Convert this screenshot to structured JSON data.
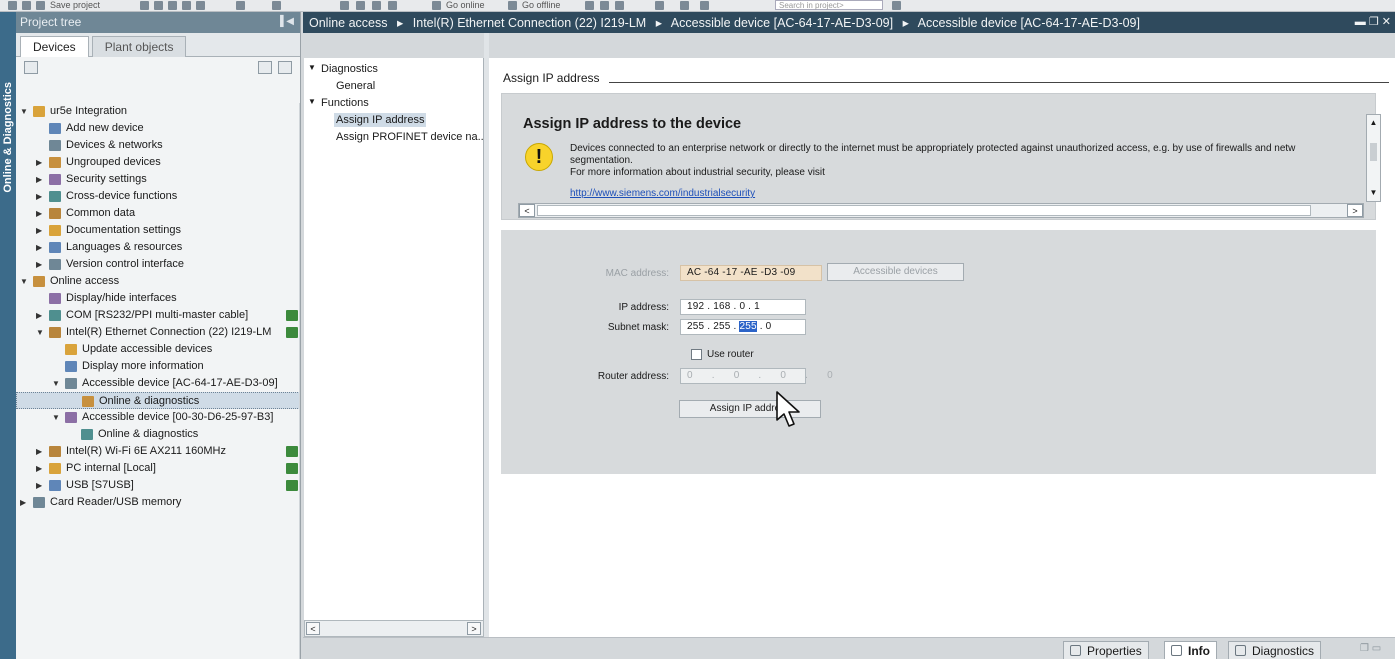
{
  "toolbar": {
    "save_label": "Save project",
    "go_online": "Go online",
    "go_offline": "Go offline",
    "search_placeholder": "Search in project>"
  },
  "side_tab": {
    "label": "Online & Diagnostics"
  },
  "project_tree": {
    "title": "Project tree",
    "tabs": [
      {
        "label": "Devices",
        "active": true
      },
      {
        "label": "Plant objects",
        "active": false
      }
    ],
    "items": [
      {
        "label": "ur5e Integration",
        "level": 0,
        "expander": "open",
        "icon": "project-icon"
      },
      {
        "label": "Add new device",
        "level": 1,
        "expander": "",
        "icon": "add-device-icon"
      },
      {
        "label": "Devices & networks",
        "level": 1,
        "expander": "",
        "icon": "network-icon"
      },
      {
        "label": "Ungrouped devices",
        "level": 1,
        "expander": "closed",
        "icon": "folder-icon"
      },
      {
        "label": "Security settings",
        "level": 1,
        "expander": "closed",
        "icon": "security-icon"
      },
      {
        "label": "Cross-device functions",
        "level": 1,
        "expander": "closed",
        "icon": "cross-device-icon"
      },
      {
        "label": "Common data",
        "level": 1,
        "expander": "closed",
        "icon": "common-data-icon"
      },
      {
        "label": "Documentation settings",
        "level": 1,
        "expander": "closed",
        "icon": "documentation-icon"
      },
      {
        "label": "Languages & resources",
        "level": 1,
        "expander": "closed",
        "icon": "languages-icon"
      },
      {
        "label": "Version control interface",
        "level": 1,
        "expander": "closed",
        "icon": "version-control-icon"
      },
      {
        "label": "Online access",
        "level": 0,
        "expander": "open",
        "icon": "online-access-icon"
      },
      {
        "label": "Display/hide interfaces",
        "level": 1,
        "expander": "",
        "icon": "interface-icon"
      },
      {
        "label": "COM [RS232/PPI multi-master cable]",
        "level": 1,
        "expander": "closed",
        "icon": "com-port-icon",
        "status": true
      },
      {
        "label": "Intel(R) Ethernet Connection (22) I219-LM",
        "level": 1,
        "expander": "open",
        "icon": "ethernet-icon",
        "status": true
      },
      {
        "label": "Update accessible devices",
        "level": 2,
        "expander": "",
        "icon": "update-icon"
      },
      {
        "label": "Display more information",
        "level": 2,
        "expander": "",
        "icon": "info-icon"
      },
      {
        "label": "Accessible device [AC-64-17-AE-D3-09]",
        "level": 2,
        "expander": "open",
        "icon": "device-icon"
      },
      {
        "label": "Online & diagnostics",
        "level": 3,
        "expander": "",
        "icon": "diagnostics-icon",
        "selected": true
      },
      {
        "label": "Accessible device [00-30-D6-25-97-B3]",
        "level": 2,
        "expander": "open",
        "icon": "device-icon"
      },
      {
        "label": "Online & diagnostics",
        "level": 3,
        "expander": "",
        "icon": "diagnostics-icon"
      },
      {
        "label": "Intel(R) Wi-Fi 6E AX211 160MHz",
        "level": 1,
        "expander": "closed",
        "icon": "wifi-icon",
        "status": true
      },
      {
        "label": "PC internal [Local]",
        "level": 1,
        "expander": "closed",
        "icon": "pc-internal-icon",
        "status": true
      },
      {
        "label": "USB [S7USB]",
        "level": 1,
        "expander": "closed",
        "icon": "usb-icon",
        "status": true
      },
      {
        "label": "Card Reader/USB memory",
        "level": 0,
        "expander": "closed",
        "icon": "card-reader-icon"
      }
    ]
  },
  "breadcrumb": {
    "items": [
      "Online access",
      "Intel(R) Ethernet Connection (22) I219-LM",
      "Accessible device [AC-64-17-AE-D3-09]",
      "Accessible device [AC-64-17-AE-D3-09]"
    ],
    "separator": "▸"
  },
  "function_nav": {
    "diagnostics": "Diagnostics",
    "general": "General",
    "functions": "Functions",
    "assign_ip": "Assign IP address",
    "assign_profinet": "Assign PROFINET device na..."
  },
  "main": {
    "section_title": "Assign IP address",
    "warning": {
      "title": "Assign IP address to the device",
      "line1": "Devices connected to an enterprise network or directly to the internet must be appropriately protected against unauthorized access, e.g. by use of firewalls and netw",
      "line2": "segmentation.",
      "line3": "For more information about industrial security, please visit",
      "link": "http://www.siemens.com/industrialsecurity"
    },
    "form": {
      "mac_label": "MAC address:",
      "mac_value": "AC -64 -17 -AE -D3 -09",
      "accessible_devices_button": "Accessible devices",
      "ip_label": "IP address:",
      "ip_value": "192 . 168 . 0 . 1",
      "subnet_label": "Subnet mask:",
      "subnet_prefix": "255 . 255 . ",
      "subnet_highlight": "255",
      "subnet_suffix": " . 0",
      "use_router_label": "Use router",
      "router_label": "Router address:",
      "router_value": "0 . 0 . 0 . 0",
      "assign_button": "Assign IP address"
    }
  },
  "bottom_tabs": {
    "properties": "Properties",
    "info": "Info",
    "diagnostics": "Diagnostics"
  },
  "colors": {
    "header_bar": "#2f4a5d",
    "tree_header": "#6f8796",
    "selection": "#cfdbe6",
    "warning_icon": "#f8d32b",
    "mac_field": "#f2e1c9",
    "highlight": "#2c64c8",
    "link": "#1d4fb8"
  }
}
